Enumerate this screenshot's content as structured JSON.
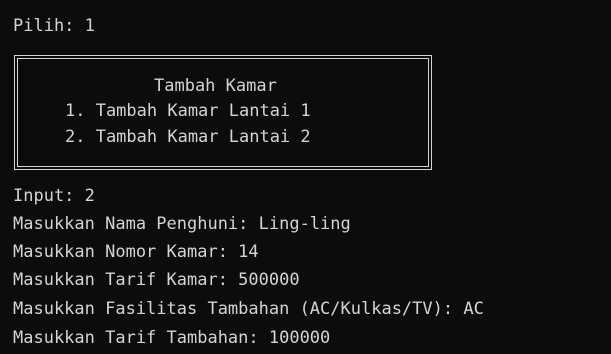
{
  "terminal": {
    "prompt_line": "Pilih: 1",
    "menu": {
      "title": "Tambah Kamar",
      "options": [
        "1. Tambah Kamar Lantai 1",
        "2. Tambah Kamar Lantai 2"
      ]
    },
    "output_lines": [
      "Input: 2",
      "Masukkan Nama Penghuni: Ling-ling",
      "Masukkan Nomor Kamar: 14",
      "Masukkan Tarif Kamar: 500000",
      "Masukkan Fasilitas Tambahan (AC/Kulkas/TV): AC",
      "Masukkan Tarif Tambahan: 100000"
    ]
  }
}
